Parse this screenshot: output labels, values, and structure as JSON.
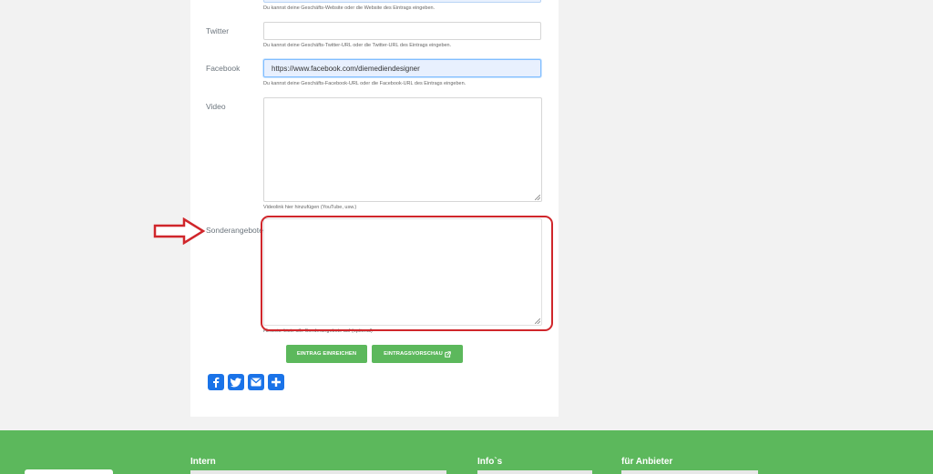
{
  "form": {
    "website": {
      "help": "Du kannst deine Geschäfts-Website oder die Website des Eintrags eingeben."
    },
    "twitter": {
      "label": "Twitter",
      "value": "",
      "help": "Du kannst deine Geschäfts-Twitter-URL oder die Twitter-URL des Eintrags eingeben."
    },
    "facebook": {
      "label": "Facebook",
      "value": "https://www.facebook.com/diemediendesigner",
      "help": "Du kannst deine Geschäfts-Facebook-URL oder die Facebook-URL des Eintrags eingeben."
    },
    "video": {
      "label": "Video",
      "help": "Videolink hier hinzufügen (YouTube, usw.)"
    },
    "offers": {
      "label": "Sonderangebote",
      "help": "Hinweis: Liste alle Sonderangebote auf (optional)"
    }
  },
  "buttons": {
    "submit": "EINTRAG EINREICHEN",
    "preview": "EINTRAGSVORSCHAU"
  },
  "share": {
    "icons": [
      "facebook-icon",
      "twitter-icon",
      "email-icon",
      "plus-icon"
    ]
  },
  "footer": {
    "col1": "Intern",
    "col2": "Info`s",
    "col3": "für Anbieter"
  },
  "colors": {
    "green": "#5cb85c",
    "highlight": "#d0262b",
    "share_blue": "#1a73e8"
  }
}
